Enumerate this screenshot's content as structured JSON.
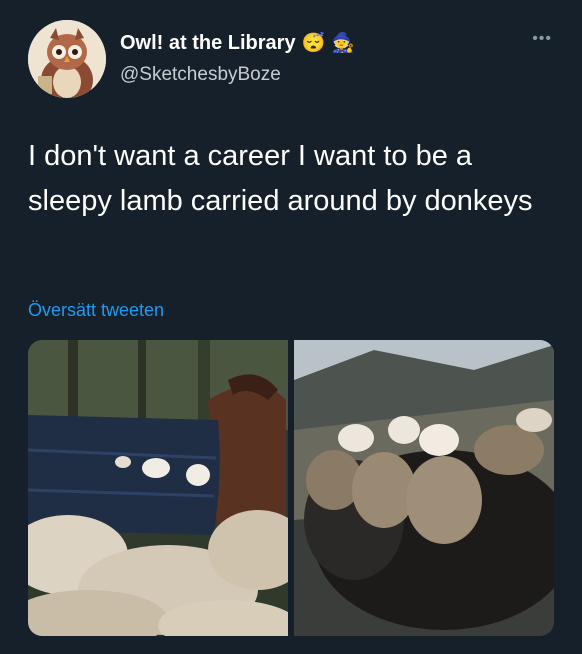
{
  "tweet": {
    "author": {
      "display_name": "Owl! at the Library",
      "handle": "@SketchesbyBoze",
      "emojis": [
        "😴",
        "🧙"
      ],
      "avatar_icon": "owl-avatar"
    },
    "text": "I don't want a career I want to be a sleepy lamb carried around by donkeys",
    "translate_link": "Översätt tweeten",
    "more_icon": "more-dots-icon",
    "media": [
      {
        "name": "photo-lambs-in-donkey-bags",
        "alt": "Donkey carrying lambs in a blue bag above a flock of sheep"
      },
      {
        "name": "photo-lambs-on-donkey-back",
        "alt": "Lambs riding in sacks on a donkey's back in the mountains"
      }
    ]
  },
  "colors": {
    "background": "#15202b",
    "text": "#ffffff",
    "secondary": "#c7ccd1",
    "link": "#1d9bf0"
  }
}
